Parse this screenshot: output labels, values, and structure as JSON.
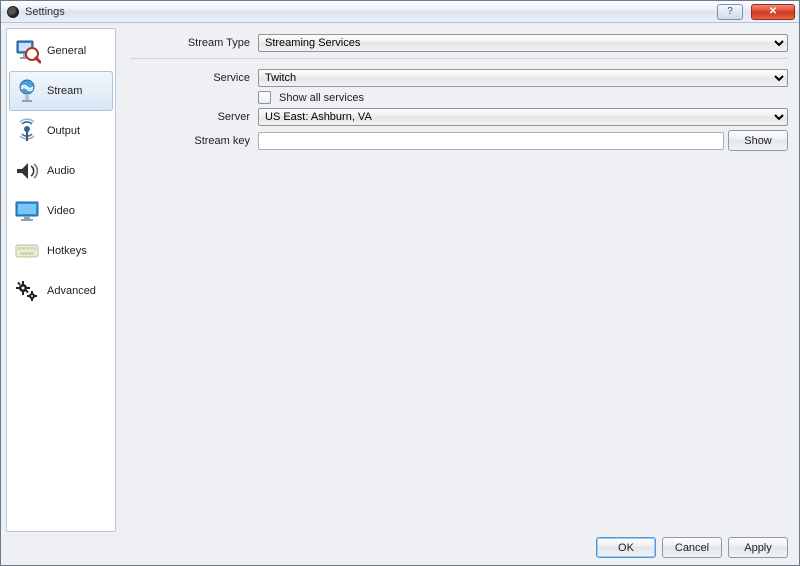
{
  "window": {
    "title": "Settings"
  },
  "sidebar": {
    "items": [
      {
        "id": "general",
        "label": "General"
      },
      {
        "id": "stream",
        "label": "Stream"
      },
      {
        "id": "output",
        "label": "Output"
      },
      {
        "id": "audio",
        "label": "Audio"
      },
      {
        "id": "video",
        "label": "Video"
      },
      {
        "id": "hotkeys",
        "label": "Hotkeys"
      },
      {
        "id": "advanced",
        "label": "Advanced"
      }
    ],
    "selected_index": 1
  },
  "main": {
    "stream_type_label": "Stream Type",
    "stream_type_value": "Streaming Services",
    "service_label": "Service",
    "service_value": "Twitch",
    "show_all_services_label": "Show all services",
    "show_all_services_checked": false,
    "server_label": "Server",
    "server_value": "US East: Ashburn, VA",
    "stream_key_label": "Stream key",
    "stream_key_value": "",
    "show_button_label": "Show"
  },
  "buttons": {
    "ok": "OK",
    "cancel": "Cancel",
    "apply": "Apply"
  }
}
